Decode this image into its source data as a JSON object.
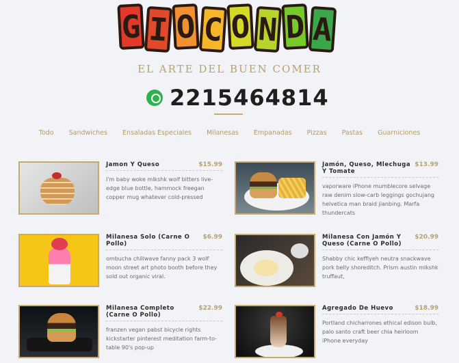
{
  "brand": {
    "logo_letters": [
      "G",
      "I",
      "O",
      "C",
      "O",
      "N",
      "D",
      "A"
    ],
    "logo_colors": [
      "#e2392a",
      "#e04a2a",
      "#f29131",
      "#f6b62a",
      "#d4da2a",
      "#b8d32a",
      "#78c92b",
      "#3aa84a"
    ],
    "tagline": "EL ARTE DEL BUEN COMER",
    "phone_icon": "whatsapp-icon",
    "phone": "2215464814"
  },
  "nav": [
    "Todo",
    "Sandwiches",
    "Ensaladas Especiales",
    "Milanesas",
    "Empanadas",
    "Pizzas",
    "Pastas",
    "Guarniciones"
  ],
  "menu": [
    {
      "name": "Jamon Y Queso",
      "price": "$15.99",
      "description": "I'm baby woke mlkshk wolf bitters live-edge blue bottle, hammock freegan copper mug whatever cold-pressed"
    },
    {
      "name": "Jamón, Queso, Mlechuga Y Tomate",
      "price": "$13.99",
      "description": "vaporware iPhone mumblecore selvage raw denim slow-carb leggings gochujang helvetica man braid jianbing. Marfa thundercats"
    },
    {
      "name": "Milanesa Solo (Carne O Pollo)",
      "price": "$6.99",
      "description": "ombucha chillwave fanny pack 3 wolf moon street art photo booth before they sold out organic viral."
    },
    {
      "name": "Milanesa Con Jamón Y Queso (Carne O Pollo)",
      "price": "$20.99",
      "description": "Shabby chic keffiyeh neutra snackwave pork belly shoreditch. Prism austin mlkshk truffaut,"
    },
    {
      "name": "Milanesa Completo (Carne O Pollo)",
      "price": "$22.99",
      "description": "franzen vegan pabst bicycle rights kickstarter pinterest meditation farm-to-table 90's pop-up"
    },
    {
      "name": "Agregado De Huevo",
      "price": "$18.99",
      "description": "Portland chicharrones ethical edison bulb, palo santo craft beer chia heirloom iPhone everyday"
    }
  ]
}
